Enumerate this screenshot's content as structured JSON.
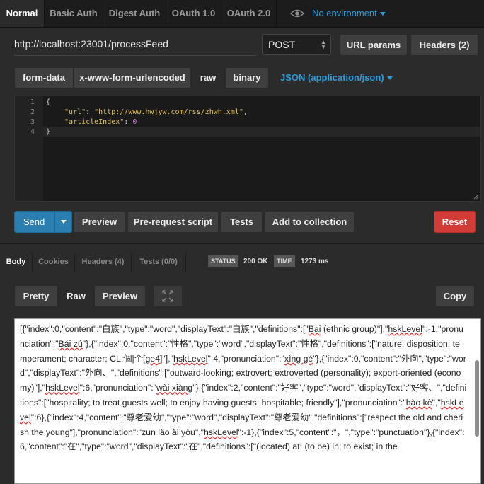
{
  "topbar": {
    "tabs": [
      "Normal",
      "Basic Auth",
      "Digest Auth",
      "OAuth 1.0",
      "OAuth 2.0"
    ],
    "environment": "No environment"
  },
  "request": {
    "url": "http://localhost:23001/processFeed",
    "method": "POST",
    "url_params_label": "URL params",
    "headers_label": "Headers (2)",
    "body_modes": [
      "form-data",
      "x-www-form-urlencoded",
      "raw",
      "binary"
    ],
    "active_body_mode": "raw",
    "content_type": "JSON (application/json)"
  },
  "editor": {
    "line_numbers": [
      "1",
      "2",
      "3",
      "4"
    ],
    "lines": {
      "l1": "{",
      "l2_key": "\"url\"",
      "l2_sep": ": ",
      "l2_val": "\"http://www.hwjyw.com/rss/zhwh.xml\"",
      "l2_end": ",",
      "l3_key": "\"articleIndex\"",
      "l3_sep": ": ",
      "l3_val": "0",
      "l4": "}"
    }
  },
  "actions": {
    "send": "Send",
    "preview": "Preview",
    "prerequest": "Pre-request script",
    "tests": "Tests",
    "add_collection": "Add to collection",
    "reset": "Reset"
  },
  "response": {
    "tabs": [
      "Body",
      "Cookies",
      "Headers (4)",
      "Tests (0/0)"
    ],
    "status_label": "STATUS",
    "status_value": "200 OK",
    "time_label": "TIME",
    "time_value": "1273 ms",
    "view_modes": [
      "Pretty",
      "Raw",
      "Preview"
    ],
    "copy": "Copy",
    "body": {
      "t1": "[{\"index\":0,\"content\":\"白族\",\"type\":\"word\",\"displayText\":\"白族\",\"definitions\":[\"",
      "u1": "Bai",
      "t2": " (ethnic group)\"],\"",
      "u2": "hskLevel",
      "t3": "\":-1,\"pronunciation\":\"",
      "u3": "Bái zú",
      "t4": "\"},{\"index\":0,\"content\":\"性格\",\"type\":\"word\",\"displayText\":\"性格\",\"definitions\":[\"nature; disposition; temperament; character; CL:個|个[",
      "u4": "ge4",
      "t5": "]\"],\"",
      "u5": "hskLevel",
      "t6": "\":4,\"pronunciation\":\"",
      "u6": "xìng gé",
      "t7": "\"},{\"index\":0,\"content\":\"外向\",\"type\":\"word\",\"displayText\":\"外向、\",\"definitions\":[\"outward-looking; extrovert; extroverted (personality); export-oriented (economy)\"],\"",
      "u7": "hskLevel",
      "t8": "\":6,\"pronunciation\":\"",
      "u8": "wài xiàng",
      "t9": "\"},{\"index\":2,\"content\":\"好客\",\"type\":\"word\",\"displayText\":\"好客、\",\"definitions\":[\"hospitality; to treat guests well; to enjoy having guests; hospitable; friendly\"],\"pronunciation\":\"",
      "u9": "hào kè",
      "t10": "\",\"",
      "u10": "hskLevel",
      "t11": "\":6},{\"index\":4,\"content\":\"尊老爱幼\",\"type\":\"word\",\"displayText\":\"尊老爱幼\",\"definitions\":[\"respect the old and cherish the young\"],\"pronunciation\":\"zūn lǎo ài yòu\",\"",
      "u11": "hskLevel",
      "t12": "\":-1},{\"index\":5,\"content\":\"，\",\"type\":\"punctuation\"},{\"index\":6,\"content\":\"在\",\"type\":\"word\",\"displayText\":\"在\",\"definitions\":[\"(located) at; (to be) in; to exist; in the"
    }
  },
  "colors": {
    "accent": "#2f9bd8",
    "send": "#2a7fb0",
    "reset": "#d33b36",
    "json_string": "#e2c46a",
    "json_number": "#c978d6"
  }
}
